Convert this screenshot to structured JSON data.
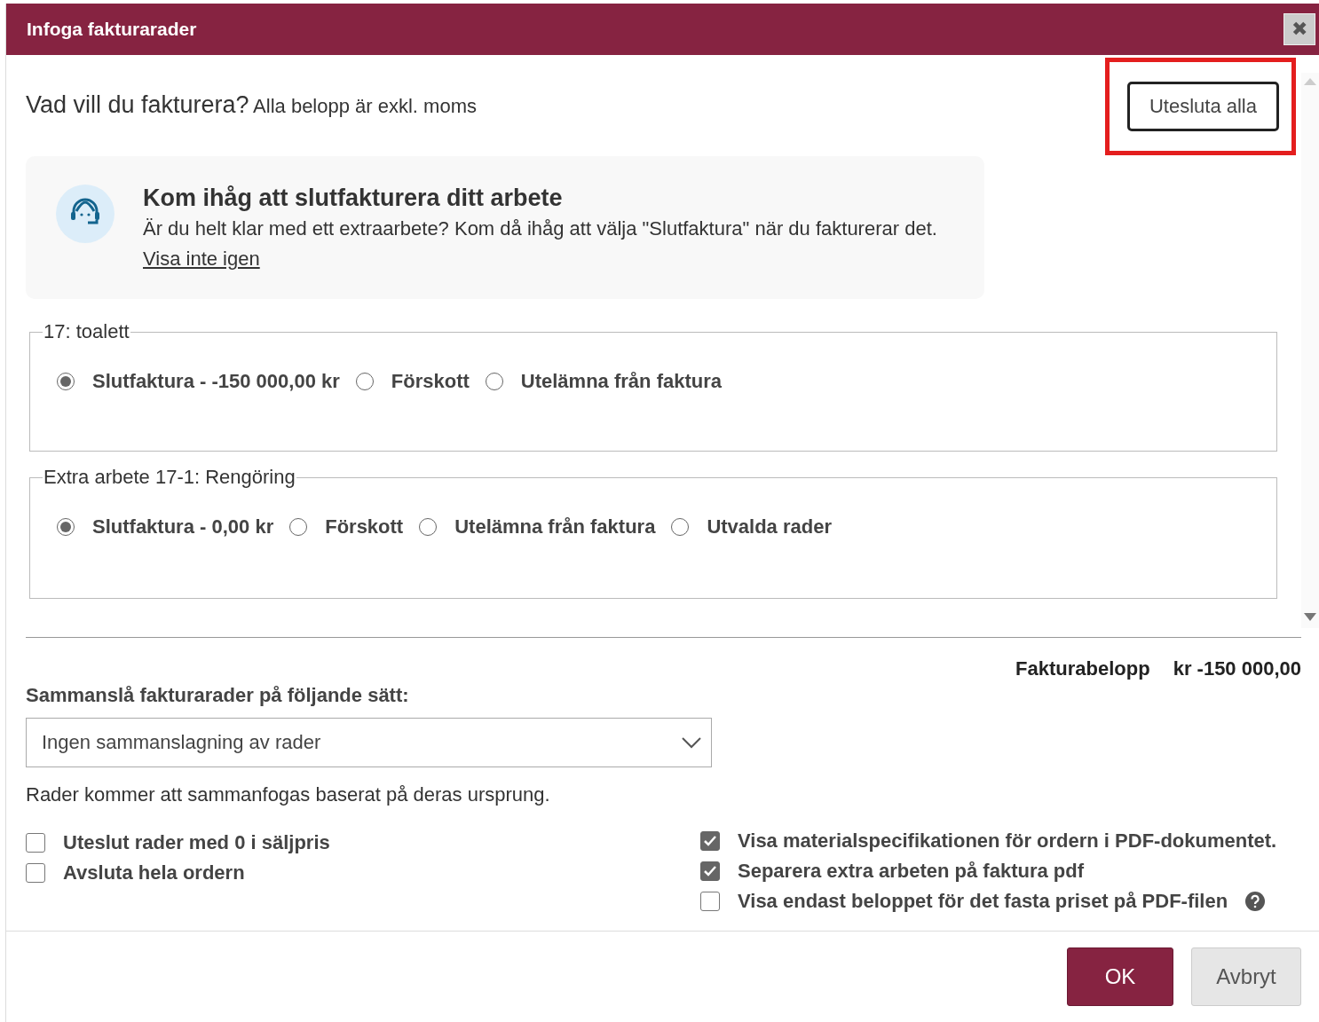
{
  "window": {
    "title": "Infoga fakturarader",
    "close": "✖"
  },
  "header": {
    "question": "Vad vill du fakturera?",
    "note": "Alla belopp är exkl. moms",
    "exclude_button": {
      "label": "Utesluta alla",
      "highlighted": true
    }
  },
  "notice": {
    "title": "Kom ihåg att slutfakturera ditt arbete",
    "text": "Är du helt klar med ett extraarbete? Kom då ihåg att välja \"Slutfaktura\" när du fakturerar det.",
    "link": "Visa inte igen"
  },
  "groups": [
    {
      "legend": "17: toalett",
      "options": [
        {
          "label": "Slutfaktura - -150 000,00 kr",
          "selected": true
        },
        {
          "label": "Förskott",
          "selected": false
        },
        {
          "label": "Utelämna från faktura",
          "selected": false
        }
      ]
    },
    {
      "legend": "Extra arbete 17-1: Rengöring",
      "options": [
        {
          "label": "Slutfaktura - 0,00 kr",
          "selected": true
        },
        {
          "label": "Förskott",
          "selected": false
        },
        {
          "label": "Utelämna från faktura",
          "selected": false
        },
        {
          "label": "Utvalda rader",
          "selected": false
        }
      ]
    }
  ],
  "total": {
    "label": "Fakturabelopp",
    "value": "kr -150 000,00"
  },
  "merge": {
    "label": "Sammanslå fakturarader på följande sätt:",
    "value": "Ingen sammanslagning av rader",
    "hint": "Rader kommer att sammanfogas baserat på deras ursprung."
  },
  "options_left": [
    {
      "label": "Uteslut rader med 0 i säljpris",
      "checked": false
    },
    {
      "label": "Avsluta hela ordern",
      "checked": false
    }
  ],
  "options_right": [
    {
      "label": "Visa materialspecifikationen för ordern i PDF-dokumentet.",
      "checked": true,
      "help": false
    },
    {
      "label": "Separera extra arbeten på faktura pdf",
      "checked": true,
      "help": false
    },
    {
      "label": "Visa endast beloppet för det fasta priset på PDF-filen",
      "checked": false,
      "help": true
    }
  ],
  "buttons": [
    {
      "label": "OK",
      "kind": "primary"
    },
    {
      "label": "Avbryt",
      "kind": "secondary"
    }
  ]
}
